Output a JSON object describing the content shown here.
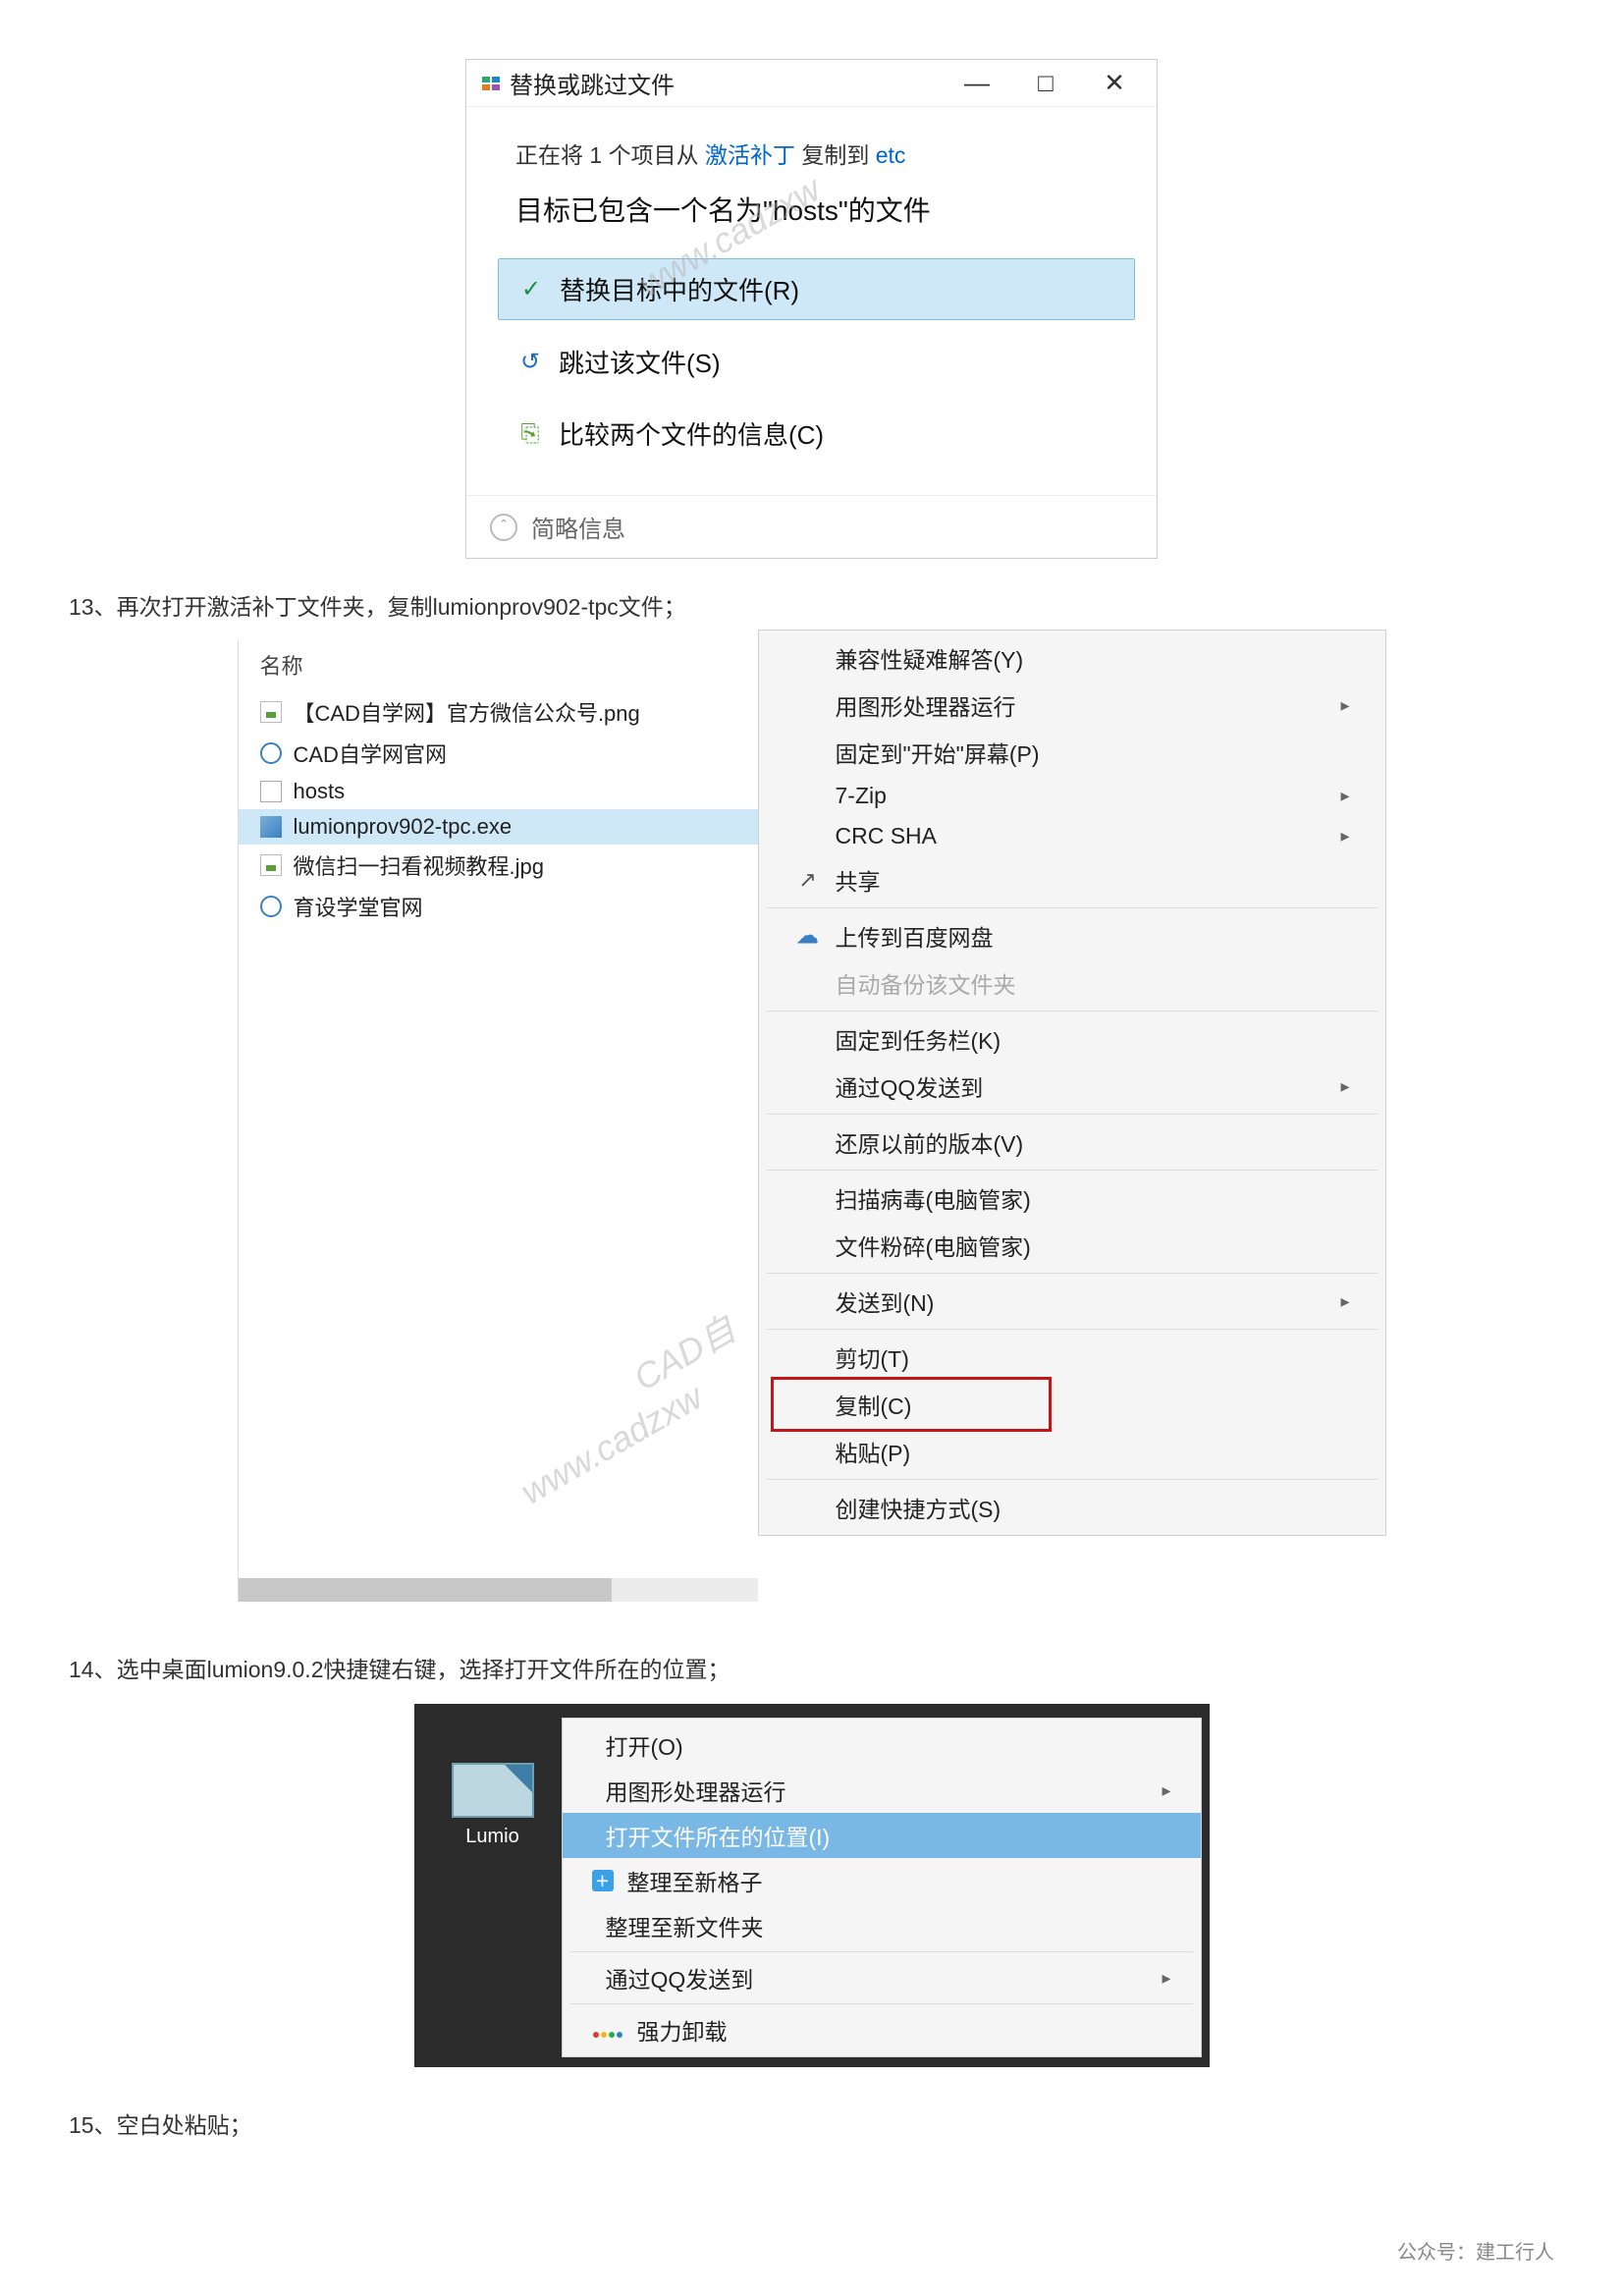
{
  "dialog1": {
    "title": "替换或跳过文件",
    "minimize": "—",
    "maximize": "□",
    "close": "✕",
    "copy_pre": "正在将 1 个项目从 ",
    "copy_link1": "激活补丁",
    "copy_mid": " 复制到 ",
    "copy_link2": "etc",
    "headline": "目标已包含一个名为\"hosts\"的文件",
    "opt_replace": "替换目标中的文件(R)",
    "opt_skip": "跳过该文件(S)",
    "opt_compare": "比较两个文件的信息(C)",
    "footer_toggle": "简略信息"
  },
  "step13": "13、再次打开激活补丁文件夹，复制lumionprov902-tpc文件；",
  "filelist": {
    "header": "名称",
    "items": [
      "【CAD自学网】官方微信公众号.png",
      "CAD自学网官网",
      "hosts",
      "lumionprov902-tpc.exe",
      "微信扫一扫看视频教程.jpg",
      "育设学堂官网"
    ]
  },
  "ctx2": {
    "compat": "兼容性疑难解答(Y)",
    "gpu": "用图形处理器运行",
    "pin_start": "固定到\"开始\"屏幕(P)",
    "zip": "7-Zip",
    "crc": "CRC SHA",
    "share": "共享",
    "baidu": "上传到百度网盘",
    "backup": "自动备份该文件夹",
    "taskbar": "固定到任务栏(K)",
    "qq": "通过QQ发送到",
    "restore": "还原以前的版本(V)",
    "scan": "扫描病毒(电脑管家)",
    "shred": "文件粉碎(电脑管家)",
    "sendto": "发送到(N)",
    "cut": "剪切(T)",
    "copy": "复制(C)",
    "paste": "粘贴(P)",
    "shortcut": "创建快捷方式(S)"
  },
  "step14": "14、选中桌面lumion9.0.2快捷键右键，选择打开文件所在的位置；",
  "deskicon_label": "Lumio",
  "ctx3": {
    "open": "打开(O)",
    "gpu": "用图形处理器运行",
    "loc": "打开文件所在的位置(I)",
    "grid": "整理至新格子",
    "folder": "整理至新文件夹",
    "qq": "通过QQ发送到",
    "uninstall": "强力卸载"
  },
  "step15": "15、空白处粘贴；",
  "watermarks": {
    "cad": "CAD自",
    "url": "www.cadzxw"
  },
  "footer": "公众号：建工行人"
}
